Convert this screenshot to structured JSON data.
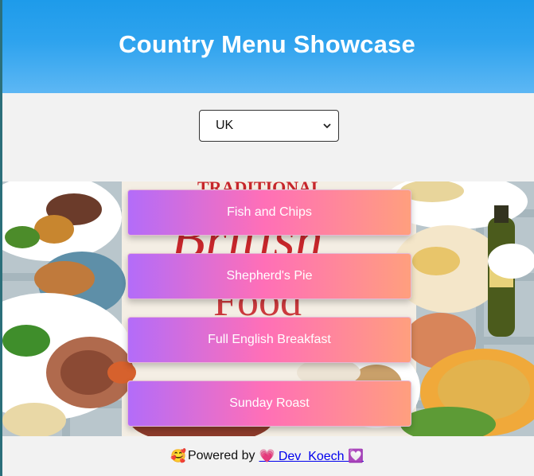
{
  "header": {
    "title": "Country Menu Showcase"
  },
  "country_select": {
    "selected": "UK"
  },
  "hero": {
    "banner_text_top": "TRADITIONAL",
    "banner_text_mid": "British",
    "banner_text_bottom": "Food"
  },
  "menu": {
    "items": [
      {
        "label": "Fish and Chips"
      },
      {
        "label": "Shepherd's Pie"
      },
      {
        "label": "Full English Breakfast"
      },
      {
        "label": "Sunday Roast"
      }
    ]
  },
  "footer": {
    "prefix_emoji": "🥰",
    "powered_text": "Powered by",
    "link_text": "💗 Dev  Koech 💟"
  },
  "colors": {
    "header_gradient_top": "#1e9bea",
    "button_gradient_start": "#b36cf9",
    "button_gradient_end": "#ff9f7e",
    "page_bg": "#f2f2f2"
  }
}
